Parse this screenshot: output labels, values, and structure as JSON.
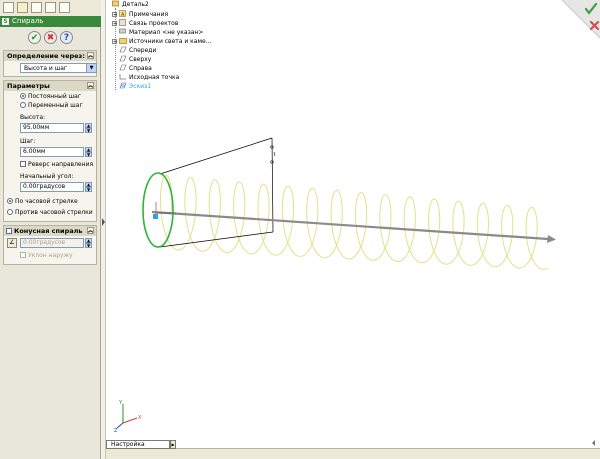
{
  "left_panel": {
    "title": "Спираль",
    "title_icon": "S",
    "actions": {
      "ok": "✔",
      "cancel": "✖",
      "help": "?"
    },
    "definition_group": {
      "title": "Определение через:",
      "selected": "Высота и шаг"
    },
    "params_group": {
      "title": "Параметры",
      "const_pitch": "Постоянный шаг",
      "variable_pitch": "Переменный шаг",
      "height_label": "Высота:",
      "height_value": "95.00мм",
      "pitch_label": "Шаг:",
      "pitch_value": "6.00мм",
      "reverse_label": "Реверс направления",
      "start_angle_label": "Начальный угол:",
      "start_angle_value": "0.00градусов",
      "clockwise": "По часовой стрелке",
      "counter_clockwise": "Против часовой стрелки"
    },
    "taper_group": {
      "title": "Конусная спираль",
      "angle_value": "0.00градусов",
      "outward_label": "Уклон наружу"
    }
  },
  "tree": {
    "root": "Деталь2",
    "items": [
      "Примечания",
      "Связь проектов",
      "Материал <не указан>",
      "Источники света и каме...",
      "Спереди",
      "Сверху",
      "Справа",
      "Исходная точка",
      "Эскиз1"
    ]
  },
  "bottom": {
    "config_tab": "Настройка"
  },
  "colors": {
    "helix": "#e3e08a",
    "circle": "#2fb33a",
    "axis": "#8a8a8a",
    "panel_bg": "#e9e6dc",
    "title_bar": "#3a8a3e",
    "confirm_check": "#3aa040",
    "confirm_x": "#d05050"
  }
}
